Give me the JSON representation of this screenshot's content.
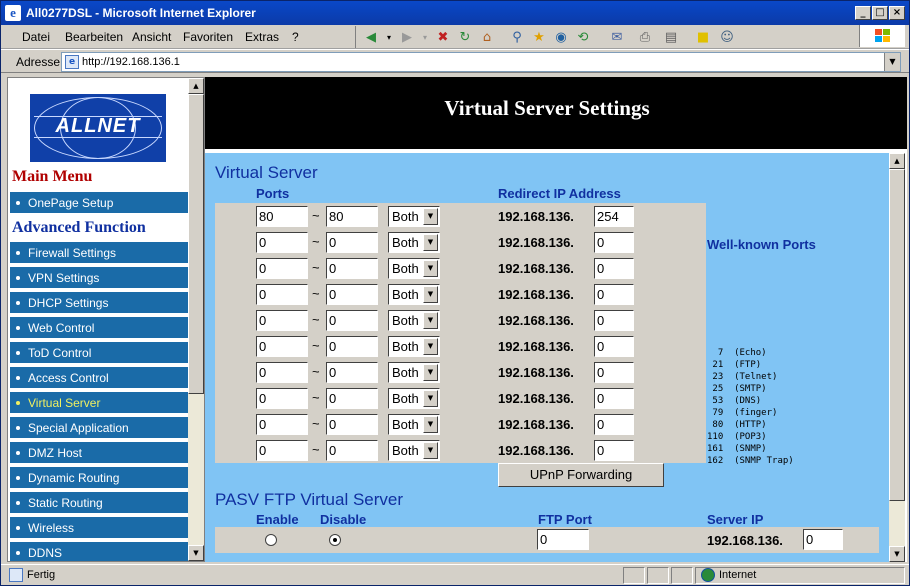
{
  "window": {
    "title": "All0277DSL - Microsoft Internet Explorer"
  },
  "menu": [
    "Datei",
    "Bearbeiten",
    "Ansicht",
    "Favoriten",
    "Extras",
    "?"
  ],
  "address": {
    "label": "Adresse",
    "url": "http://192.168.136.1"
  },
  "sidebar": {
    "logo_text": "ALLNET",
    "main_menu_title": "Main Menu",
    "advanced_title": "Advanced Function",
    "items": [
      {
        "label": "OnePage Setup"
      },
      {
        "label": "Firewall Settings"
      },
      {
        "label": "VPN Settings"
      },
      {
        "label": "DHCP Settings"
      },
      {
        "label": "Web Control"
      },
      {
        "label": "ToD Control"
      },
      {
        "label": "Access Control"
      },
      {
        "label": "Virtual Server",
        "active": true
      },
      {
        "label": "Special Application"
      },
      {
        "label": "DMZ Host"
      },
      {
        "label": "Dynamic Routing"
      },
      {
        "label": "Static Routing"
      },
      {
        "label": "Wireless"
      },
      {
        "label": "DDNS"
      }
    ]
  },
  "page": {
    "title": "Virtual Server Settings",
    "vs_section": "Virtual Server",
    "ports_header": "Ports",
    "redirect_header": "Redirect IP Address",
    "ip_prefix": "192.168.136.",
    "tilde": "~",
    "rows": [
      {
        "from": "80",
        "to": "80",
        "proto": "Both",
        "ip": "254"
      },
      {
        "from": "0",
        "to": "0",
        "proto": "Both",
        "ip": "0"
      },
      {
        "from": "0",
        "to": "0",
        "proto": "Both",
        "ip": "0"
      },
      {
        "from": "0",
        "to": "0",
        "proto": "Both",
        "ip": "0"
      },
      {
        "from": "0",
        "to": "0",
        "proto": "Both",
        "ip": "0"
      },
      {
        "from": "0",
        "to": "0",
        "proto": "Both",
        "ip": "0"
      },
      {
        "from": "0",
        "to": "0",
        "proto": "Both",
        "ip": "0"
      },
      {
        "from": "0",
        "to": "0",
        "proto": "Both",
        "ip": "0"
      },
      {
        "from": "0",
        "to": "0",
        "proto": "Both",
        "ip": "0"
      },
      {
        "from": "0",
        "to": "0",
        "proto": "Both",
        "ip": "0"
      }
    ],
    "upnp_button": "UPnP Forwarding",
    "well_known_title": "Well-known Ports",
    "well_known": [
      "  7  (Echo)",
      " 21  (FTP)",
      " 23  (Telnet)",
      " 25  (SMTP)",
      " 53  (DNS)",
      " 79  (finger)",
      " 80  (HTTP)",
      "110  (POP3)",
      "161  (SNMP)",
      "162  (SNMP Trap)"
    ],
    "pasv_title": "PASV FTP Virtual Server",
    "pasv_enable": "Enable",
    "pasv_disable": "Disable",
    "ftp_port_label": "FTP Port",
    "server_ip_label": "Server IP",
    "ftp_port_value": "0",
    "server_ip_suffix": "0",
    "pasv_selected": "Disable"
  },
  "status": {
    "text": "Fertig",
    "zone": "Internet"
  }
}
